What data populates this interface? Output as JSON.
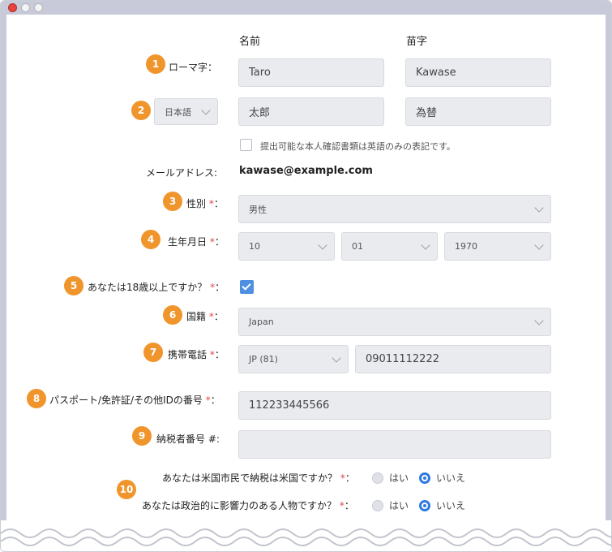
{
  "columns": {
    "first_name": "名前",
    "last_name": "苗字"
  },
  "rows": {
    "romaji": {
      "num": "1",
      "label": "ローマ字：",
      "first": "Taro",
      "last": "Kawase"
    },
    "native": {
      "num": "2",
      "language": "日本語",
      "first": "太郎",
      "last": "為替"
    },
    "note": "提出可能な本人確認書類は英語のみの表記です。",
    "email": {
      "label": "メールアドレス:",
      "value": "kawase@example.com"
    },
    "gender": {
      "num": "3",
      "label": "性別",
      "req": "*",
      "colon": "：",
      "value": "男性"
    },
    "dob": {
      "num": "4",
      "label": "生年月日",
      "req": "*",
      "colon": "：",
      "day": "10",
      "month": "01",
      "year": "1970"
    },
    "age": {
      "num": "5",
      "label": "あなたは18歳以上ですか？",
      "req": "*",
      "colon": "：",
      "checked": true
    },
    "nationality": {
      "num": "6",
      "label": "国籍",
      "req": "*",
      "colon": "：",
      "value": "Japan"
    },
    "mobile": {
      "num": "7",
      "label": "携帯電話",
      "req": "*",
      "colon": "：",
      "code": "JP (81)",
      "number": "09011112222"
    },
    "passport": {
      "num": "8",
      "label": "パスポート/免許証/その他IDの番号",
      "req": "*",
      "colon": "：",
      "value": "112233445566"
    },
    "tax": {
      "num": "9",
      "label": "納税者番号 #:",
      "value": ""
    },
    "us_citizen": {
      "num": "10",
      "label": "あなたは米国市民で納税は米国ですか？",
      "req": "*",
      "colon": "：",
      "yes": "はい",
      "no": "いいえ",
      "selected": "no"
    },
    "pep": {
      "label": "あなたは政治的に影響力のある人物ですか？",
      "req": "*",
      "colon": "：",
      "yes": "はい",
      "no": "いいえ",
      "selected": "no"
    }
  },
  "colors": {
    "badge": "#f0952b",
    "accent": "#2f7ae0",
    "required": "#e04848"
  }
}
